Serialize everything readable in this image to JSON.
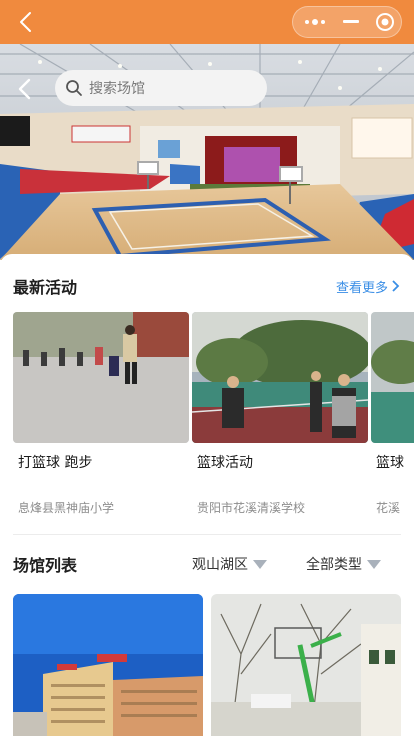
{
  "navbar": {
    "back_icon": "chevron-left-icon",
    "capsule": {
      "menu_icon": "more-dots-icon",
      "minimize_icon": "minus-icon",
      "close_icon": "target-icon"
    },
    "color": "#f08a3e"
  },
  "hero": {
    "back_icon": "chevron-left-icon",
    "search": {
      "placeholder": "搜索场馆",
      "icon": "search-icon"
    }
  },
  "latest": {
    "title": "最新活动",
    "more_label": "查看更多",
    "items": [
      {
        "title": "打篮球 跑步",
        "place": "息烽县黑神庙小学"
      },
      {
        "title": "篮球活动",
        "place": "贵阳市花溪清溪学校"
      },
      {
        "title": "篮球",
        "place": "花溪"
      }
    ]
  },
  "venues": {
    "title": "场馆列表",
    "filter_district": "观山湖区",
    "filter_type": "全部类型"
  },
  "colors": {
    "accent": "#f08a3e",
    "link": "#3a8ee6",
    "muted": "#8d8d8d"
  }
}
